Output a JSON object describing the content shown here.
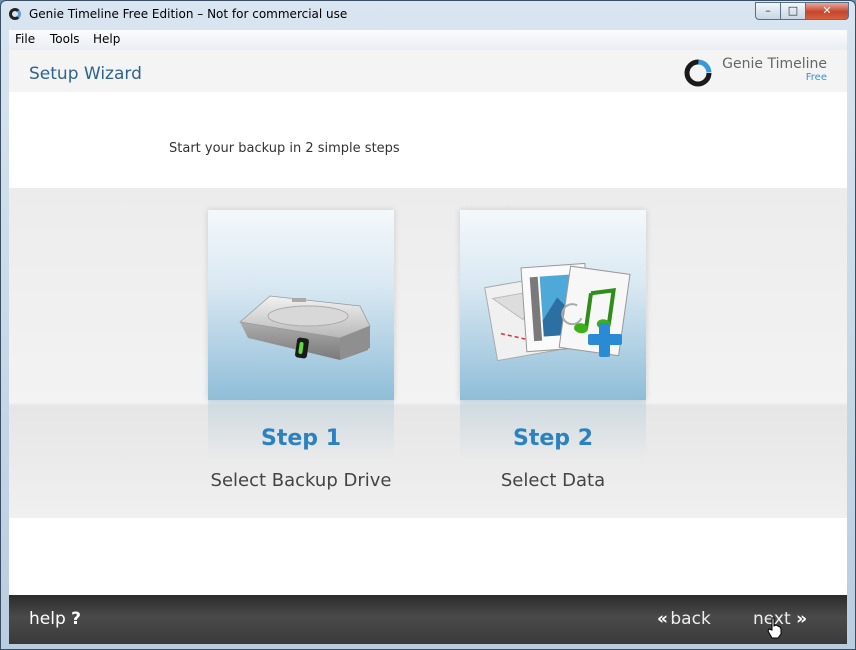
{
  "window": {
    "title": "Genie Timeline Free Edition – Not for commercial use",
    "controls": {
      "minimize": "–",
      "maximize": "□",
      "close": "✕"
    }
  },
  "menu": {
    "items": [
      "File",
      "Tools",
      "Help"
    ]
  },
  "header": {
    "title": "Setup Wizard",
    "brand_name": "Genie Timeline",
    "brand_edition": "Free"
  },
  "intro": "Start your backup in 2 simple steps",
  "steps": [
    {
      "title": "Step 1",
      "label": "Select Backup Drive",
      "icon": "hard-drive-icon"
    },
    {
      "title": "Step 2",
      "label": "Select Data",
      "icon": "documents-music-icon"
    }
  ],
  "footer": {
    "help_label": "help",
    "help_symbol": "?",
    "back_label": "back",
    "next_label": "next",
    "back_chevrons": "«",
    "next_chevrons": "»"
  },
  "colors": {
    "accent": "#2c82c0",
    "wizard_title": "#2d6390",
    "footer_bg": "#333333"
  }
}
